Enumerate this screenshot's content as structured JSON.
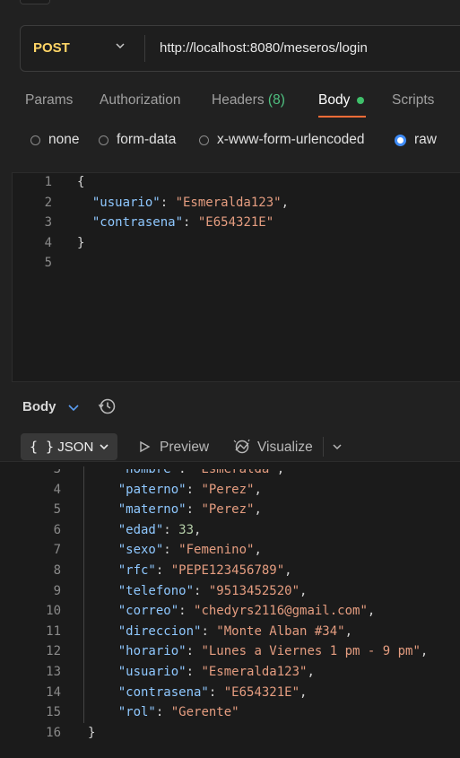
{
  "request": {
    "method": "POST",
    "url": "http://localhost:8080/meseros/login"
  },
  "tabs": {
    "params": "Params",
    "authorization": "Authorization",
    "headers": "Headers",
    "headers_count": "(8)",
    "body": "Body",
    "scripts": "Scripts"
  },
  "body_types": {
    "none": "none",
    "form_data": "form-data",
    "urlencoded": "x-www-form-urlencoded",
    "raw": "raw",
    "selected": "raw"
  },
  "request_body": {
    "lines": [
      {
        "n": "1",
        "parts": [
          [
            "p",
            "{"
          ]
        ]
      },
      {
        "n": "2",
        "parts": [
          [
            "p",
            "  "
          ],
          [
            "k",
            "\"usuario\""
          ],
          [
            "p",
            ": "
          ],
          [
            "s",
            "\"Esmeralda123\""
          ],
          [
            "p",
            ","
          ]
        ]
      },
      {
        "n": "3",
        "parts": [
          [
            "p",
            "  "
          ],
          [
            "k",
            "\"contrasena\""
          ],
          [
            "p",
            ": "
          ],
          [
            "s",
            "\"E654321E\""
          ]
        ]
      },
      {
        "n": "4",
        "parts": [
          [
            "p",
            "}"
          ]
        ]
      },
      {
        "n": "5",
        "parts": []
      }
    ]
  },
  "response": {
    "label": "Body",
    "format": "JSON",
    "preview": "Preview",
    "visualize": "Visualize",
    "lines": [
      {
        "n": "3",
        "parts": [
          [
            "p",
            "    "
          ],
          [
            "k",
            "\"nombre\""
          ],
          [
            "p",
            ": "
          ],
          [
            "s",
            "\"Esmeralda\""
          ],
          [
            "p",
            ","
          ]
        ]
      },
      {
        "n": "4",
        "parts": [
          [
            "p",
            "    "
          ],
          [
            "k",
            "\"paterno\""
          ],
          [
            "p",
            ": "
          ],
          [
            "s",
            "\"Perez\""
          ],
          [
            "p",
            ","
          ]
        ]
      },
      {
        "n": "5",
        "parts": [
          [
            "p",
            "    "
          ],
          [
            "k",
            "\"materno\""
          ],
          [
            "p",
            ": "
          ],
          [
            "s",
            "\"Perez\""
          ],
          [
            "p",
            ","
          ]
        ]
      },
      {
        "n": "6",
        "parts": [
          [
            "p",
            "    "
          ],
          [
            "k",
            "\"edad\""
          ],
          [
            "p",
            ": "
          ],
          [
            "n",
            "33"
          ],
          [
            "p",
            ","
          ]
        ]
      },
      {
        "n": "7",
        "parts": [
          [
            "p",
            "    "
          ],
          [
            "k",
            "\"sexo\""
          ],
          [
            "p",
            ": "
          ],
          [
            "s",
            "\"Femenino\""
          ],
          [
            "p",
            ","
          ]
        ]
      },
      {
        "n": "8",
        "parts": [
          [
            "p",
            "    "
          ],
          [
            "k",
            "\"rfc\""
          ],
          [
            "p",
            ": "
          ],
          [
            "s",
            "\"PEPE123456789\""
          ],
          [
            "p",
            ","
          ]
        ]
      },
      {
        "n": "9",
        "parts": [
          [
            "p",
            "    "
          ],
          [
            "k",
            "\"telefono\""
          ],
          [
            "p",
            ": "
          ],
          [
            "s",
            "\"9513452520\""
          ],
          [
            "p",
            ","
          ]
        ]
      },
      {
        "n": "10",
        "parts": [
          [
            "p",
            "    "
          ],
          [
            "k",
            "\"correo\""
          ],
          [
            "p",
            ": "
          ],
          [
            "s",
            "\"chedyrs2116@gmail.com\""
          ],
          [
            "p",
            ","
          ]
        ]
      },
      {
        "n": "11",
        "parts": [
          [
            "p",
            "    "
          ],
          [
            "k",
            "\"direccion\""
          ],
          [
            "p",
            ": "
          ],
          [
            "s",
            "\"Monte Alban #34\""
          ],
          [
            "p",
            ","
          ]
        ]
      },
      {
        "n": "12",
        "parts": [
          [
            "p",
            "    "
          ],
          [
            "k",
            "\"horario\""
          ],
          [
            "p",
            ": "
          ],
          [
            "s",
            "\"Lunes a Viernes 1 pm - 9 pm\""
          ],
          [
            "p",
            ","
          ]
        ]
      },
      {
        "n": "13",
        "parts": [
          [
            "p",
            "    "
          ],
          [
            "k",
            "\"usuario\""
          ],
          [
            "p",
            ": "
          ],
          [
            "s",
            "\"Esmeralda123\""
          ],
          [
            "p",
            ","
          ]
        ]
      },
      {
        "n": "14",
        "parts": [
          [
            "p",
            "    "
          ],
          [
            "k",
            "\"contrasena\""
          ],
          [
            "p",
            ": "
          ],
          [
            "s",
            "\"E654321E\""
          ],
          [
            "p",
            ","
          ]
        ]
      },
      {
        "n": "15",
        "parts": [
          [
            "p",
            "    "
          ],
          [
            "k",
            "\"rol\""
          ],
          [
            "p",
            ": "
          ],
          [
            "s",
            "\"Gerente\""
          ]
        ]
      },
      {
        "n": "16",
        "parts": [
          [
            "p",
            "}"
          ]
        ]
      }
    ]
  },
  "colors": {
    "method": "#ffd566",
    "accent": "#ff6c37",
    "active_dot": "#3fbf6a",
    "radio_selected": "#3f8cf7",
    "json_key": "#8fc8ff",
    "json_string": "#e59d80",
    "json_number": "#b5cea8"
  },
  "icons": {
    "method_dropdown": "chevron-down-icon",
    "response_dropdown": "chevron-down-icon",
    "history": "history-icon",
    "json_braces": "braces-icon",
    "preview": "play-icon",
    "visualize": "visualize-icon",
    "more": "chevron-down-icon"
  }
}
